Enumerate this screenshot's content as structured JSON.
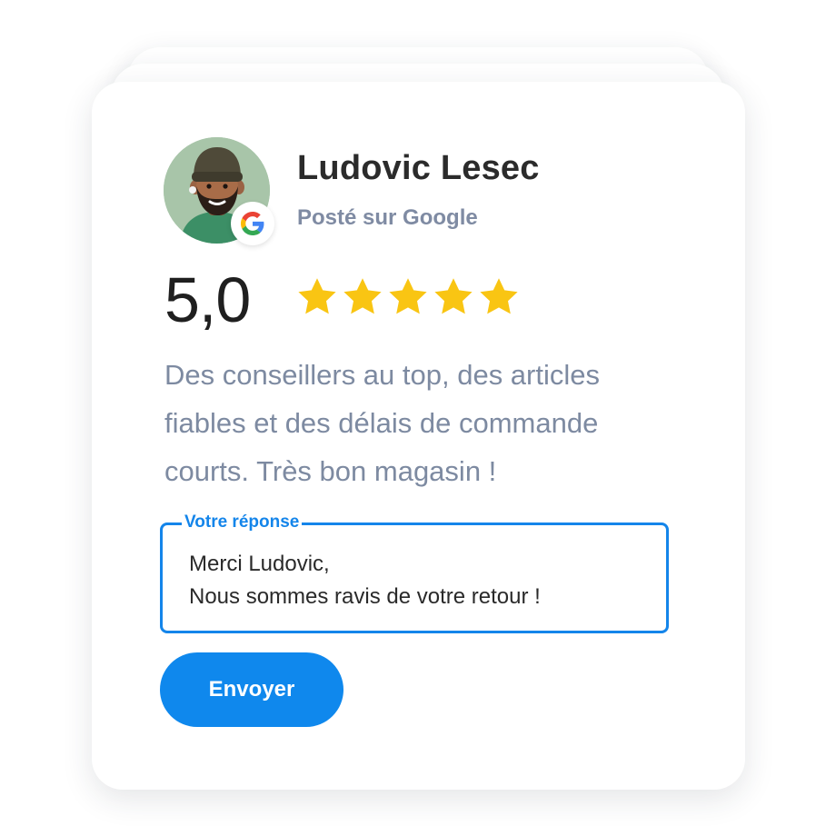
{
  "review": {
    "reviewer_name": "Ludovic Lesec",
    "posted_on": "Posté sur Google",
    "rating_value": "5,0",
    "rating_stars": 5,
    "rating_max": 5,
    "text": "Des conseillers au top, des articles fiables et des délais de commande courts. Très bon magasin !"
  },
  "response": {
    "label": "Votre réponse",
    "line_1": "Merci Ludovic,",
    "line_2": "Nous sommes ravis de votre retour !"
  },
  "actions": {
    "send_label": "Envoyer"
  },
  "colors": {
    "accent": "#1485ea",
    "button": "#0f88ed",
    "star": "#f9c513",
    "muted_text": "#7d8aa1",
    "avatar_bg": "#a8c5a9"
  },
  "icons": {
    "avatar": "reviewer-avatar",
    "badge": "google-icon",
    "rating": "star-icon"
  }
}
